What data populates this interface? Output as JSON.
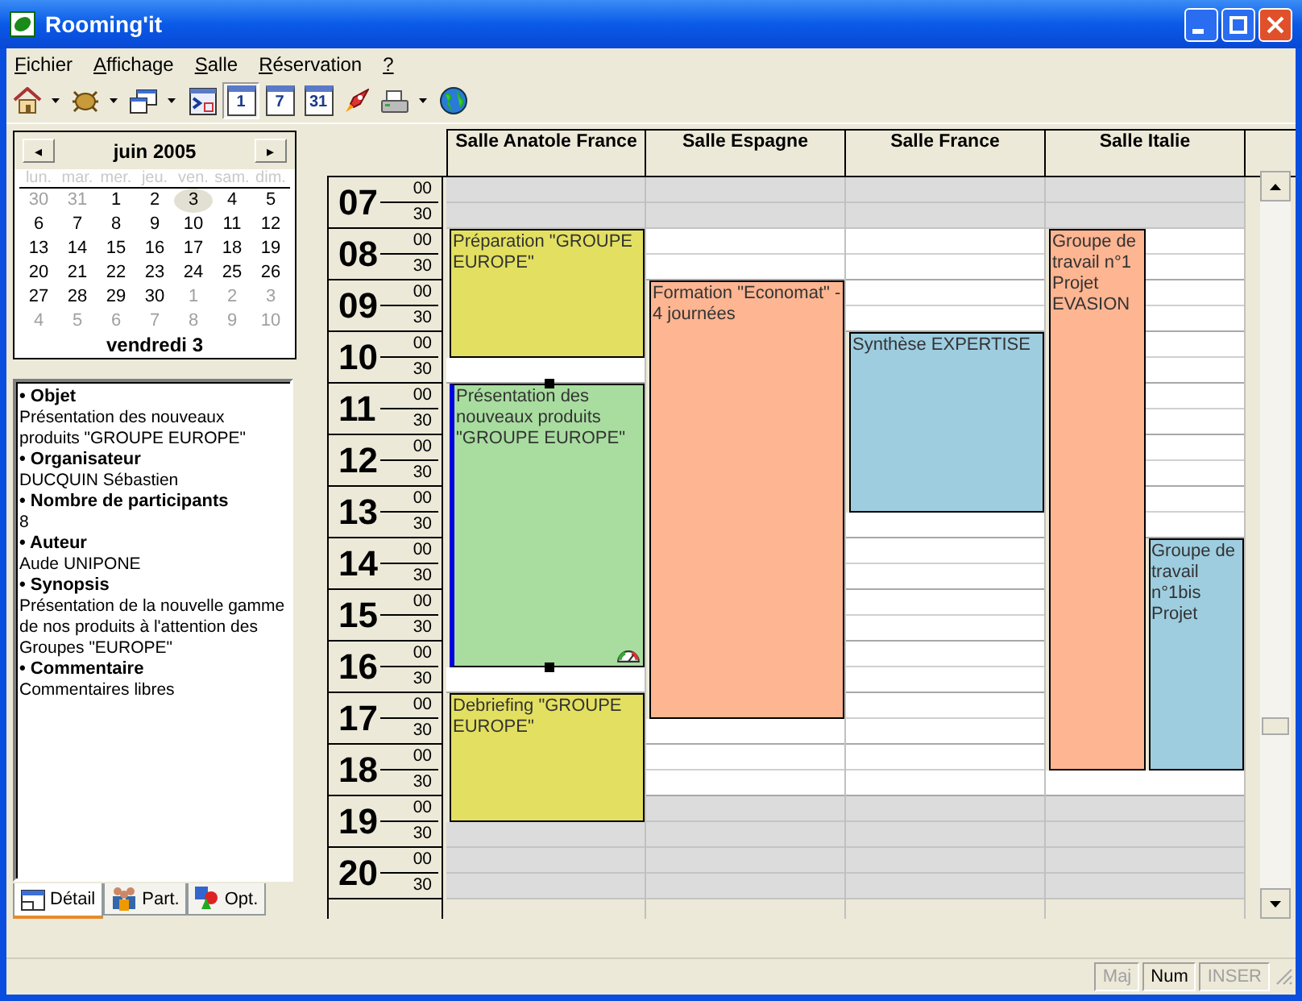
{
  "window": {
    "title": "Rooming'it"
  },
  "menu": [
    {
      "label": "Fichier"
    },
    {
      "label": "Affichage"
    },
    {
      "label": "Salle"
    },
    {
      "label": "Réservation"
    },
    {
      "label": "?"
    }
  ],
  "toolbar": [
    {
      "kind": "home",
      "dropdown": true,
      "selected": false
    },
    {
      "kind": "bug",
      "dropdown": true,
      "selected": false
    },
    {
      "kind": "windows",
      "dropdown": true,
      "selected": false
    },
    {
      "kind": "goto",
      "dropdown": false,
      "selected": false
    },
    {
      "kind": "calendar",
      "text": "1",
      "dropdown": false,
      "selected": true
    },
    {
      "kind": "calendar",
      "text": "7",
      "dropdown": false,
      "selected": false
    },
    {
      "kind": "calendar",
      "text": "31",
      "dropdown": false,
      "selected": false
    },
    {
      "kind": "rocket",
      "dropdown": false,
      "selected": false
    },
    {
      "kind": "printer",
      "dropdown": true,
      "selected": false
    },
    {
      "kind": "globe",
      "dropdown": false,
      "selected": false
    }
  ],
  "calendar": {
    "month": "juin 2005",
    "prev": "◂",
    "next": "▸",
    "weekdays": [
      "lun.",
      "mar.",
      "mer.",
      "jeu.",
      "ven.",
      "sam.",
      "dim."
    ],
    "weeks": [
      [
        {
          "day": "30",
          "other": true,
          "selected": false
        },
        {
          "day": "31",
          "other": true,
          "selected": false
        },
        {
          "day": "1",
          "other": false,
          "selected": false
        },
        {
          "day": "2",
          "other": false,
          "selected": false
        },
        {
          "day": "3",
          "other": false,
          "selected": true
        },
        {
          "day": "4",
          "other": false,
          "selected": false
        },
        {
          "day": "5",
          "other": false,
          "selected": false
        }
      ],
      [
        {
          "day": "6",
          "other": false,
          "selected": false
        },
        {
          "day": "7",
          "other": false,
          "selected": false
        },
        {
          "day": "8",
          "other": false,
          "selected": false
        },
        {
          "day": "9",
          "other": false,
          "selected": false
        },
        {
          "day": "10",
          "other": false,
          "selected": false
        },
        {
          "day": "11",
          "other": false,
          "selected": false
        },
        {
          "day": "12",
          "other": false,
          "selected": false
        }
      ],
      [
        {
          "day": "13",
          "other": false,
          "selected": false
        },
        {
          "day": "14",
          "other": false,
          "selected": false
        },
        {
          "day": "15",
          "other": false,
          "selected": false
        },
        {
          "day": "16",
          "other": false,
          "selected": false
        },
        {
          "day": "17",
          "other": false,
          "selected": false
        },
        {
          "day": "18",
          "other": false,
          "selected": false
        },
        {
          "day": "19",
          "other": false,
          "selected": false
        }
      ],
      [
        {
          "day": "20",
          "other": false,
          "selected": false
        },
        {
          "day": "21",
          "other": false,
          "selected": false
        },
        {
          "day": "22",
          "other": false,
          "selected": false
        },
        {
          "day": "23",
          "other": false,
          "selected": false
        },
        {
          "day": "24",
          "other": false,
          "selected": false
        },
        {
          "day": "25",
          "other": false,
          "selected": false
        },
        {
          "day": "26",
          "other": false,
          "selected": false
        }
      ],
      [
        {
          "day": "27",
          "other": false,
          "selected": false
        },
        {
          "day": "28",
          "other": false,
          "selected": false
        },
        {
          "day": "29",
          "other": false,
          "selected": false
        },
        {
          "day": "30",
          "other": false,
          "selected": false
        },
        {
          "day": "1",
          "other": true,
          "selected": false
        },
        {
          "day": "2",
          "other": true,
          "selected": false
        },
        {
          "day": "3",
          "other": true,
          "selected": false
        }
      ],
      [
        {
          "day": "4",
          "other": true,
          "selected": false
        },
        {
          "day": "5",
          "other": true,
          "selected": false
        },
        {
          "day": "6",
          "other": true,
          "selected": false
        },
        {
          "day": "7",
          "other": true,
          "selected": false
        },
        {
          "day": "8",
          "other": true,
          "selected": false
        },
        {
          "day": "9",
          "other": true,
          "selected": false
        },
        {
          "day": "10",
          "other": true,
          "selected": false
        }
      ]
    ],
    "footer": "vendredi 3"
  },
  "details": [
    {
      "label": "• Objet",
      "value": "Présentation des nouveaux produits \"GROUPE EUROPE\""
    },
    {
      "label": "• Organisateur",
      "value": "DUCQUIN Sébastien"
    },
    {
      "label": "• Nombre de participants",
      "value": "8"
    },
    {
      "label": "• Auteur",
      "value": "Aude UNIPONE"
    },
    {
      "label": "• Synopsis",
      "value": "Présentation de la nouvelle gamme de nos produits à l'attention des Groupes \"EUROPE\""
    },
    {
      "label": "• Commentaire",
      "value": "Commentaires libres"
    }
  ],
  "left_tabs": [
    {
      "label": "Détail",
      "kind": "detail",
      "selected": true
    },
    {
      "label": "Part.",
      "kind": "people",
      "selected": false
    },
    {
      "label": "Opt.",
      "kind": "shapes",
      "selected": false
    }
  ],
  "rooms": [
    {
      "name": "Salle Anatole France"
    },
    {
      "name": "Salle Espagne"
    },
    {
      "name": "Salle France"
    },
    {
      "name": "Salle Italie"
    }
  ],
  "slots": [
    {
      "hour": "07",
      "minute": "00",
      "closed": true,
      "rooms": [
        [
          {
            "kind": "free"
          }
        ],
        [
          {
            "kind": "free"
          }
        ],
        [
          {
            "kind": "free"
          }
        ],
        [
          {
            "kind": "free"
          },
          {
            "kind": "free"
          }
        ]
      ]
    },
    {
      "minute": "30",
      "closed": true,
      "rooms": [
        [
          {
            "kind": "free"
          }
        ],
        [
          {
            "kind": "free"
          }
        ],
        [
          {
            "kind": "free"
          }
        ],
        [
          {
            "kind": "free"
          },
          {
            "kind": "free"
          }
        ]
      ]
    },
    {
      "hour": "08",
      "minute": "00",
      "closed": false,
      "rooms": [
        [
          {
            "kind": "start",
            "title": "Préparation \"GROUPE EUROPE\"",
            "color": "#e3e061",
            "selected": false
          }
        ],
        [
          {
            "kind": "free"
          }
        ],
        [
          {
            "kind": "free"
          }
        ],
        [
          {
            "kind": "start",
            "title": "Groupe de travail n°1 Projet EVASION",
            "color": "#fdb592",
            "selected": false
          },
          {
            "kind": "free"
          }
        ]
      ]
    },
    {
      "minute": "30",
      "closed": false,
      "rooms": [
        [
          {
            "kind": "busy"
          }
        ],
        [
          {
            "kind": "free"
          }
        ],
        [
          {
            "kind": "free"
          }
        ],
        [
          {
            "kind": "busy"
          },
          {
            "kind": "free"
          }
        ]
      ]
    },
    {
      "hour": "09",
      "minute": "00",
      "closed": false,
      "rooms": [
        [
          {
            "kind": "busy"
          }
        ],
        [
          {
            "kind": "start",
            "title": "Formation \"Economat\" - 4 journées",
            "color": "#fdb592",
            "selected": false
          }
        ],
        [
          {
            "kind": "free"
          }
        ],
        [
          {
            "kind": "busy"
          },
          {
            "kind": "free"
          }
        ]
      ]
    },
    {
      "minute": "30",
      "closed": false,
      "rooms": [
        [
          {
            "kind": "busy"
          }
        ],
        [
          {
            "kind": "busy"
          }
        ],
        [
          {
            "kind": "free"
          }
        ],
        [
          {
            "kind": "busy"
          },
          {
            "kind": "free"
          }
        ]
      ]
    },
    {
      "hour": "10",
      "minute": "00",
      "closed": false,
      "rooms": [
        [
          {
            "kind": "busy"
          }
        ],
        [
          {
            "kind": "busy"
          }
        ],
        [
          {
            "kind": "start",
            "title": "Synthèse EXPERTISE",
            "color": "#9ecde0",
            "selected": false
          }
        ],
        [
          {
            "kind": "busy"
          },
          {
            "kind": "free"
          }
        ]
      ]
    },
    {
      "minute": "30",
      "closed": false,
      "rooms": [
        [
          {
            "kind": "free"
          }
        ],
        [
          {
            "kind": "busy"
          }
        ],
        [
          {
            "kind": "busy"
          }
        ],
        [
          {
            "kind": "busy"
          },
          {
            "kind": "free"
          }
        ]
      ]
    },
    {
      "hour": "11",
      "minute": "00",
      "closed": false,
      "rooms": [
        [
          {
            "kind": "start",
            "title": "Présentation des nouveaux produits \"GROUPE EUROPE\"",
            "color": "#a8dd9f",
            "selected": true
          }
        ],
        [
          {
            "kind": "busy"
          }
        ],
        [
          {
            "kind": "busy"
          }
        ],
        [
          {
            "kind": "busy"
          },
          {
            "kind": "free"
          }
        ]
      ]
    },
    {
      "minute": "30",
      "closed": false,
      "rooms": [
        [
          {
            "kind": "busy"
          }
        ],
        [
          {
            "kind": "busy"
          }
        ],
        [
          {
            "kind": "busy"
          }
        ],
        [
          {
            "kind": "busy"
          },
          {
            "kind": "free"
          }
        ]
      ]
    },
    {
      "hour": "12",
      "minute": "00",
      "closed": false,
      "rooms": [
        [
          {
            "kind": "busy"
          }
        ],
        [
          {
            "kind": "busy"
          }
        ],
        [
          {
            "kind": "busy"
          }
        ],
        [
          {
            "kind": "busy"
          },
          {
            "kind": "free"
          }
        ]
      ]
    },
    {
      "minute": "30",
      "closed": false,
      "rooms": [
        [
          {
            "kind": "busy"
          }
        ],
        [
          {
            "kind": "busy"
          }
        ],
        [
          {
            "kind": "busy"
          }
        ],
        [
          {
            "kind": "busy"
          },
          {
            "kind": "free"
          }
        ]
      ]
    },
    {
      "hour": "13",
      "minute": "00",
      "closed": false,
      "rooms": [
        [
          {
            "kind": "busy"
          }
        ],
        [
          {
            "kind": "busy"
          }
        ],
        [
          {
            "kind": "busy"
          }
        ],
        [
          {
            "kind": "busy"
          },
          {
            "kind": "free"
          }
        ]
      ]
    },
    {
      "minute": "30",
      "closed": false,
      "rooms": [
        [
          {
            "kind": "busy"
          }
        ],
        [
          {
            "kind": "busy"
          }
        ],
        [
          {
            "kind": "free"
          }
        ],
        [
          {
            "kind": "busy"
          },
          {
            "kind": "free"
          }
        ]
      ]
    },
    {
      "hour": "14",
      "minute": "00",
      "closed": false,
      "rooms": [
        [
          {
            "kind": "busy"
          }
        ],
        [
          {
            "kind": "busy"
          }
        ],
        [
          {
            "kind": "free"
          }
        ],
        [
          {
            "kind": "busy"
          },
          {
            "kind": "start",
            "title": "Groupe de travail n°1bis Projet",
            "color": "#9ecde0",
            "selected": false
          }
        ]
      ]
    },
    {
      "minute": "30",
      "closed": false,
      "rooms": [
        [
          {
            "kind": "busy"
          }
        ],
        [
          {
            "kind": "busy"
          }
        ],
        [
          {
            "kind": "free"
          }
        ],
        [
          {
            "kind": "busy"
          },
          {
            "kind": "busy"
          }
        ]
      ]
    },
    {
      "hour": "15",
      "minute": "00",
      "closed": false,
      "rooms": [
        [
          {
            "kind": "busy"
          }
        ],
        [
          {
            "kind": "busy"
          }
        ],
        [
          {
            "kind": "free"
          }
        ],
        [
          {
            "kind": "busy"
          },
          {
            "kind": "busy"
          }
        ]
      ]
    },
    {
      "minute": "30",
      "closed": false,
      "rooms": [
        [
          {
            "kind": "busy"
          }
        ],
        [
          {
            "kind": "busy"
          }
        ],
        [
          {
            "kind": "free"
          }
        ],
        [
          {
            "kind": "busy"
          },
          {
            "kind": "busy"
          }
        ]
      ]
    },
    {
      "hour": "16",
      "minute": "00",
      "closed": false,
      "rooms": [
        [
          {
            "kind": "busy"
          }
        ],
        [
          {
            "kind": "busy"
          }
        ],
        [
          {
            "kind": "free"
          }
        ],
        [
          {
            "kind": "busy"
          },
          {
            "kind": "busy"
          }
        ]
      ]
    },
    {
      "minute": "30",
      "closed": false,
      "rooms": [
        [
          {
            "kind": "free"
          }
        ],
        [
          {
            "kind": "busy"
          }
        ],
        [
          {
            "kind": "free"
          }
        ],
        [
          {
            "kind": "busy"
          },
          {
            "kind": "busy"
          }
        ]
      ]
    },
    {
      "hour": "17",
      "minute": "00",
      "closed": false,
      "rooms": [
        [
          {
            "kind": "start",
            "title": "Debriefing \"GROUPE EUROPE\"",
            "color": "#e3e061",
            "selected": false
          }
        ],
        [
          {
            "kind": "busy"
          }
        ],
        [
          {
            "kind": "free"
          }
        ],
        [
          {
            "kind": "busy"
          },
          {
            "kind": "busy"
          }
        ]
      ]
    },
    {
      "minute": "30",
      "closed": false,
      "rooms": [
        [
          {
            "kind": "busy"
          }
        ],
        [
          {
            "kind": "free"
          }
        ],
        [
          {
            "kind": "free"
          }
        ],
        [
          {
            "kind": "busy"
          },
          {
            "kind": "busy"
          }
        ]
      ]
    },
    {
      "hour": "18",
      "minute": "00",
      "closed": false,
      "rooms": [
        [
          {
            "kind": "busy"
          }
        ],
        [
          {
            "kind": "free"
          }
        ],
        [
          {
            "kind": "free"
          }
        ],
        [
          {
            "kind": "busy"
          },
          {
            "kind": "busy"
          }
        ]
      ]
    },
    {
      "minute": "30",
      "closed": false,
      "rooms": [
        [
          {
            "kind": "busy"
          }
        ],
        [
          {
            "kind": "free"
          }
        ],
        [
          {
            "kind": "free"
          }
        ],
        [
          {
            "kind": "free"
          },
          {
            "kind": "free"
          }
        ]
      ]
    },
    {
      "hour": "19",
      "minute": "00",
      "closed": true,
      "rooms": [
        [
          {
            "kind": "busy"
          }
        ],
        [
          {
            "kind": "free"
          }
        ],
        [
          {
            "kind": "free"
          }
        ],
        [
          {
            "kind": "free"
          },
          {
            "kind": "free"
          }
        ]
      ]
    },
    {
      "minute": "30",
      "closed": true,
      "rooms": [
        [
          {
            "kind": "free"
          }
        ],
        [
          {
            "kind": "free"
          }
        ],
        [
          {
            "kind": "free"
          }
        ],
        [
          {
            "kind": "free"
          },
          {
            "kind": "free"
          }
        ]
      ]
    },
    {
      "hour": "20",
      "minute": "00",
      "closed": true,
      "rooms": [
        [
          {
            "kind": "free"
          }
        ],
        [
          {
            "kind": "free"
          }
        ],
        [
          {
            "kind": "free"
          }
        ],
        [
          {
            "kind": "free"
          },
          {
            "kind": "free"
          }
        ]
      ]
    },
    {
      "minute": "30",
      "closed": true,
      "rooms": [
        [
          {
            "kind": "free"
          }
        ],
        [
          {
            "kind": "free"
          }
        ],
        [
          {
            "kind": "free"
          }
        ],
        [
          {
            "kind": "free"
          },
          {
            "kind": "free"
          }
        ]
      ]
    }
  ],
  "status_bar": [
    {
      "label": "Maj",
      "on": false
    },
    {
      "label": "Num",
      "on": true
    },
    {
      "label": "INSER",
      "on": false
    }
  ]
}
